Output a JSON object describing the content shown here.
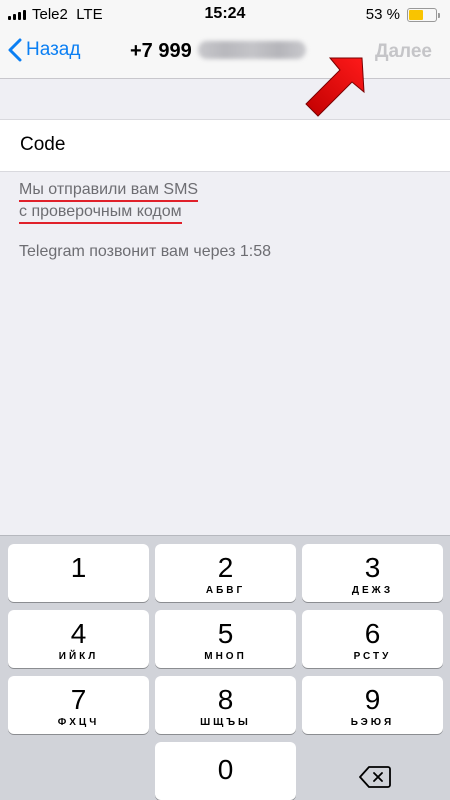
{
  "status_bar": {
    "carrier": "Tele2  LTE",
    "time": "15:24",
    "battery": "53 %",
    "battery_level": 0.53
  },
  "nav": {
    "back_label": "Назад",
    "phone_prefix": "+7 999",
    "next_label": "Далее"
  },
  "code_field": {
    "placeholder": "Code"
  },
  "info": {
    "sms_line1": "Мы отправили вам SMS",
    "sms_line2": "с проверочным кодом",
    "call_text": "Telegram позвонит вам через 1:58"
  },
  "keypad": [
    {
      "digit": "1",
      "letters": ""
    },
    {
      "digit": "2",
      "letters": "АБВГ"
    },
    {
      "digit": "3",
      "letters": "ДЕЖЗ"
    },
    {
      "digit": "4",
      "letters": "ИЙКЛ"
    },
    {
      "digit": "5",
      "letters": "МНОП"
    },
    {
      "digit": "6",
      "letters": "РСТУ"
    },
    {
      "digit": "7",
      "letters": "ФХЦЧ"
    },
    {
      "digit": "8",
      "letters": "ШЩЪЫ"
    },
    {
      "digit": "9",
      "letters": "ЬЭЮЯ"
    },
    {
      "digit": "0",
      "letters": ""
    }
  ],
  "colors": {
    "accent": "#0b7ff3",
    "annotation_red": "#e0202a",
    "battery": "#f9c400"
  }
}
